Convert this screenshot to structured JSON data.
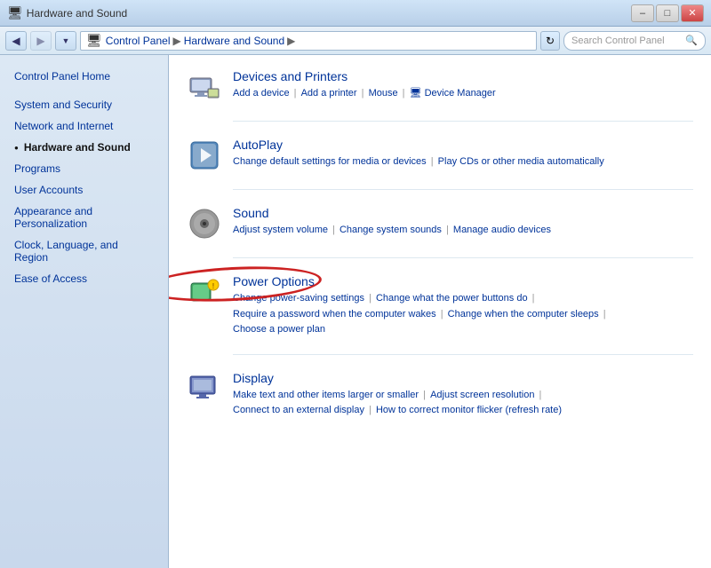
{
  "titlebar": {
    "title": "Hardware and Sound",
    "min_label": "–",
    "max_label": "□",
    "close_label": "✕"
  },
  "addressbar": {
    "back_title": "◀",
    "forward_title": "▶",
    "dropdown_title": "▼",
    "refresh_title": "↻",
    "breadcrumbs": [
      "Control Panel",
      "Hardware and Sound"
    ],
    "search_placeholder": "Search Control Panel",
    "search_icon": "🔍"
  },
  "sidebar": {
    "items": [
      {
        "id": "control-panel-home",
        "label": "Control Panel Home",
        "active": false
      },
      {
        "id": "system-and-security",
        "label": "System and Security",
        "active": false
      },
      {
        "id": "network-and-internet",
        "label": "Network and Internet",
        "active": false
      },
      {
        "id": "hardware-and-sound",
        "label": "Hardware and Sound",
        "active": true
      },
      {
        "id": "programs",
        "label": "Programs",
        "active": false
      },
      {
        "id": "user-accounts",
        "label": "User Accounts",
        "active": false
      },
      {
        "id": "appearance-and-personalization",
        "label": "Appearance and Personalization",
        "active": false
      },
      {
        "id": "clock-language-region",
        "label": "Clock, Language, and Region",
        "active": false
      },
      {
        "id": "ease-of-access",
        "label": "Ease of Access",
        "active": false
      }
    ]
  },
  "categories": [
    {
      "id": "devices-and-printers",
      "title": "Devices and Printers",
      "icon": "devices",
      "links": [
        {
          "id": "add-device",
          "label": "Add a device"
        },
        {
          "id": "add-printer",
          "label": "Add a printer"
        },
        {
          "id": "mouse",
          "label": "Mouse"
        },
        {
          "id": "device-manager",
          "label": "Device Manager"
        }
      ]
    },
    {
      "id": "autoplay",
      "title": "AutoPlay",
      "icon": "autoplay",
      "links": [
        {
          "id": "change-default-settings",
          "label": "Change default settings for media or devices"
        },
        {
          "id": "play-cds",
          "label": "Play CDs or other media automatically"
        }
      ]
    },
    {
      "id": "sound",
      "title": "Sound",
      "icon": "sound",
      "links": [
        {
          "id": "adjust-volume",
          "label": "Adjust system volume"
        },
        {
          "id": "change-sounds",
          "label": "Change system sounds"
        },
        {
          "id": "manage-audio",
          "label": "Manage audio devices"
        }
      ]
    },
    {
      "id": "power-options",
      "title": "Power Options",
      "icon": "power",
      "highlighted": true,
      "links": [
        {
          "id": "change-power-saving",
          "label": "Change power-saving settings"
        },
        {
          "id": "change-power-buttons",
          "label": "Change what the power buttons do"
        },
        {
          "id": "require-password-wake",
          "label": "Require a password when the computer wakes"
        },
        {
          "id": "change-computer-sleeps",
          "label": "Change when the computer sleeps"
        },
        {
          "id": "choose-power-plan",
          "label": "Choose a power plan"
        }
      ]
    },
    {
      "id": "display",
      "title": "Display",
      "icon": "display",
      "links": [
        {
          "id": "make-text-larger",
          "label": "Make text and other items larger or smaller"
        },
        {
          "id": "adjust-resolution",
          "label": "Adjust screen resolution"
        },
        {
          "id": "connect-external",
          "label": "Connect to an external display"
        },
        {
          "id": "correct-flicker",
          "label": "How to correct monitor flicker (refresh rate)"
        }
      ]
    }
  ]
}
